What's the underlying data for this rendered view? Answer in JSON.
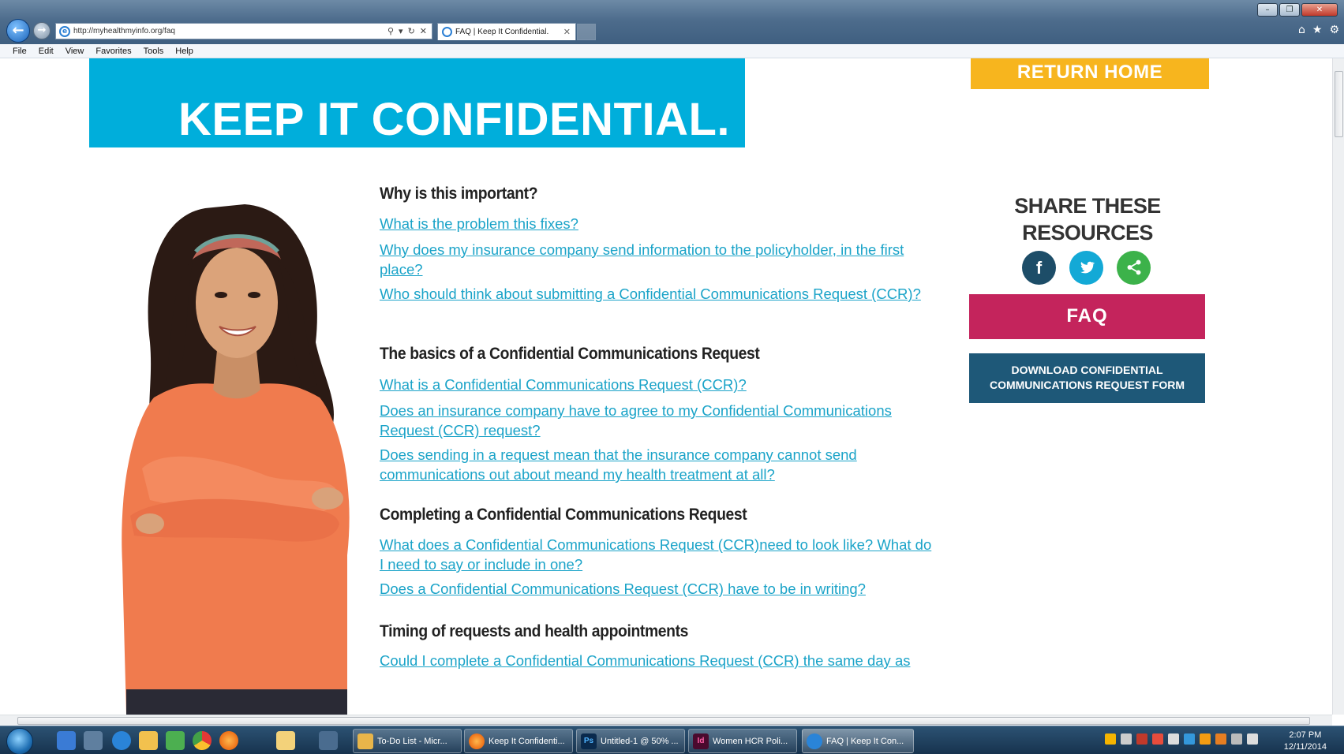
{
  "browser": {
    "address_url": "http://myhealthmyinfo.org/faq",
    "tab_title": "FAQ | Keep It Confidential.",
    "menu": [
      "File",
      "Edit",
      "View",
      "Favorites",
      "Tools",
      "Help"
    ]
  },
  "page": {
    "banner_title": "KEEP IT CONFIDENTIAL.",
    "return_home": "RETURN HOME",
    "sections": [
      {
        "heading": "Why is this important?",
        "links": [
          "What is the problem this fixes?",
          "Why does my insurance company send information to the policyholder, in the first place?",
          "Who should think about submitting a Confidential Communications Request (CCR)?"
        ]
      },
      {
        "heading": "The basics of a Confidential Communications Request",
        "links": [
          "What is a Confidential Communications Request (CCR)?",
          "Does an insurance company have to agree to my Confidential Communications Request (CCR) request?",
          "Does sending in a request mean that the insurance company cannot send communications out about meand my health treatment at all?"
        ]
      },
      {
        "heading": "Completing a Confidential Communications Request",
        "links": [
          "What does a Confidential Communications Request (CCR)need to look like? What do I need to say or include in one?",
          "Does a Confidential Communications Request (CCR) have to be in writing?"
        ]
      },
      {
        "heading": "Timing of requests and health appointments",
        "links": [
          "Could I complete a Confidential Communications Request (CCR) the same day as"
        ]
      }
    ],
    "share_title": "SHARE THESE RESOURCES",
    "faq_button": "FAQ",
    "download_button": "DOWNLOAD CONFIDENTIAL COMMUNICATIONS REQUEST FORM",
    "social_icons": [
      "facebook-icon",
      "twitter-icon",
      "share-icon"
    ]
  },
  "taskbar": {
    "tasks": [
      "To-Do List - Micr...",
      "Keep It Confidenti...",
      "Untitled-1 @ 50% ...",
      "Women HCR Poli...",
      "FAQ | Keep It Con..."
    ],
    "task_badges": [
      "Ps",
      "Id"
    ],
    "time": "2:07 PM",
    "date": "12/11/2014"
  },
  "colors": {
    "banner": "#00aedb",
    "return_home": "#f7b51e",
    "link": "#1aa3c8",
    "faq_button": "#c4245c",
    "download_button": "#1e5878",
    "facebook": "#1d4d68",
    "twitter": "#13a9d6",
    "share": "#3cb24a"
  }
}
